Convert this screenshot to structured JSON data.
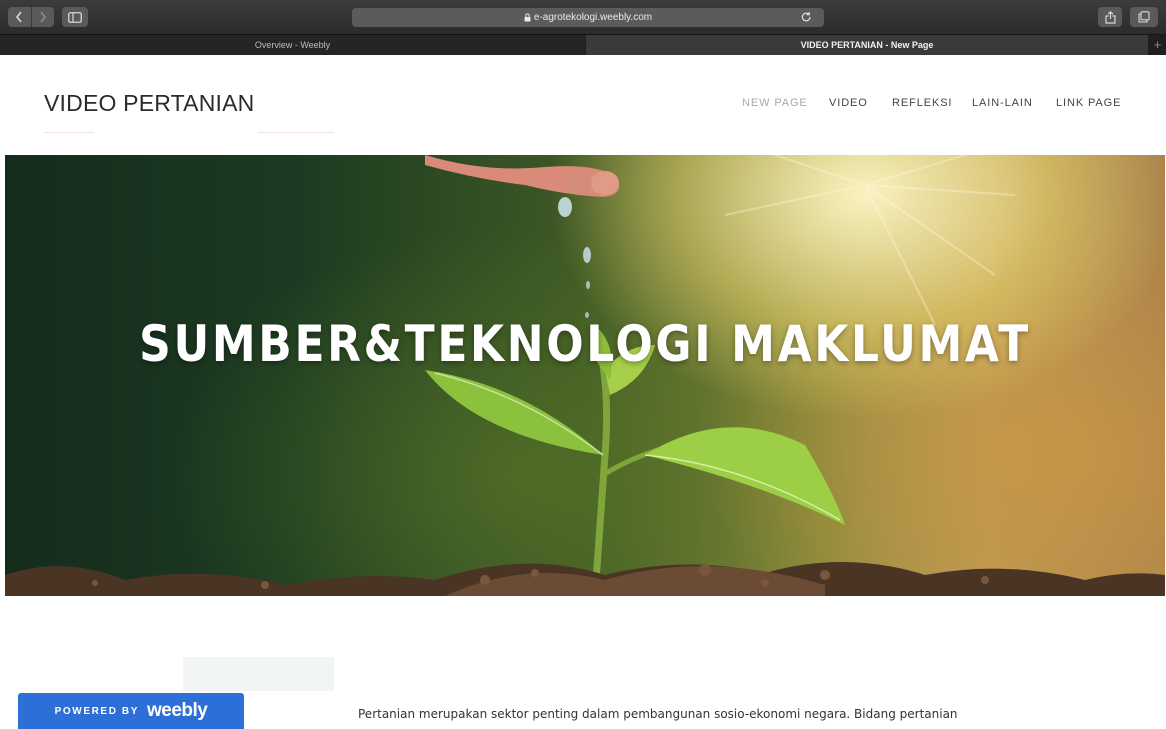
{
  "browser": {
    "url": "e-agrotekologi.weebly.com",
    "tabs": [
      {
        "label": "Overview - Weebly",
        "active": false
      },
      {
        "label": "VIDEO PERTANIAN - New Page",
        "active": true
      }
    ],
    "icons": {
      "back": "chevron-left-icon",
      "forward": "chevron-right-icon",
      "sidebar": "sidebar-icon",
      "lock": "lock-icon",
      "reload": "reload-icon",
      "share": "share-icon",
      "tabs": "tabs-overview-icon",
      "new_tab": "plus-icon"
    },
    "new_tab_symbol": "+"
  },
  "site": {
    "title": "VIDEO PERTANIAN",
    "nav": [
      {
        "label": "NEW PAGE",
        "current": true
      },
      {
        "label": "VIDEO",
        "current": false
      },
      {
        "label": "REFLEKSI",
        "current": false
      },
      {
        "label": "LAIN-LAIN",
        "current": false
      },
      {
        "label": "LINK PAGE",
        "current": false
      }
    ]
  },
  "hero": {
    "heading": "SUMBER&TEKNOLOGI MAKLUMAT"
  },
  "content": {
    "paragraph": "Pertanian merupakan sektor penting dalam pembangunan sosio-ekonomi negara. Bidang pertanian"
  },
  "badge": {
    "label": "POWERED BY",
    "brand": "weebly",
    "color": "#2c6fd6"
  }
}
